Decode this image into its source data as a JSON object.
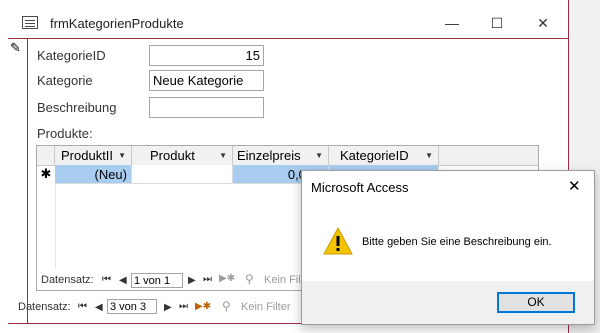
{
  "window": {
    "title": "frmKategorienProdukte",
    "minimize_glyph": "—",
    "maximize_glyph": "☐",
    "close_glyph": "✕"
  },
  "form": {
    "record_indicator": "✎",
    "fields": {
      "kategorie_id_label": "KategorieID",
      "kategorie_id_value": "15",
      "kategorie_label": "Kategorie",
      "kategorie_value": "Neue Kategorie",
      "beschreibung_label": "Beschreibung",
      "beschreibung_value": ""
    },
    "subform_label": "Produkte:"
  },
  "subform": {
    "columns": [
      "ProduktII",
      "Produkt",
      "Einzelpreis",
      "KategorieID"
    ],
    "new_row_marker": "✱",
    "new_row": {
      "produkt_id": "(Neu)",
      "produkt": "",
      "einzelpreis": "0,00 €",
      "kategorie_id": ""
    },
    "nav": {
      "label": "Datensatz:",
      "position": "1 von 1",
      "filter": "Kein Fil"
    }
  },
  "main_nav": {
    "label": "Datensatz:",
    "position": "3 von 3",
    "filter": "Kein Filter"
  },
  "dialog": {
    "title": "Microsoft Access",
    "message": "Bitte geben Sie eine Beschreibung ein.",
    "ok_label": "OK",
    "close_glyph": "✕"
  },
  "colors": {
    "accent_border": "#9b2d40",
    "selected_cell": "#a9cdf0",
    "warning": "#f5c400"
  }
}
